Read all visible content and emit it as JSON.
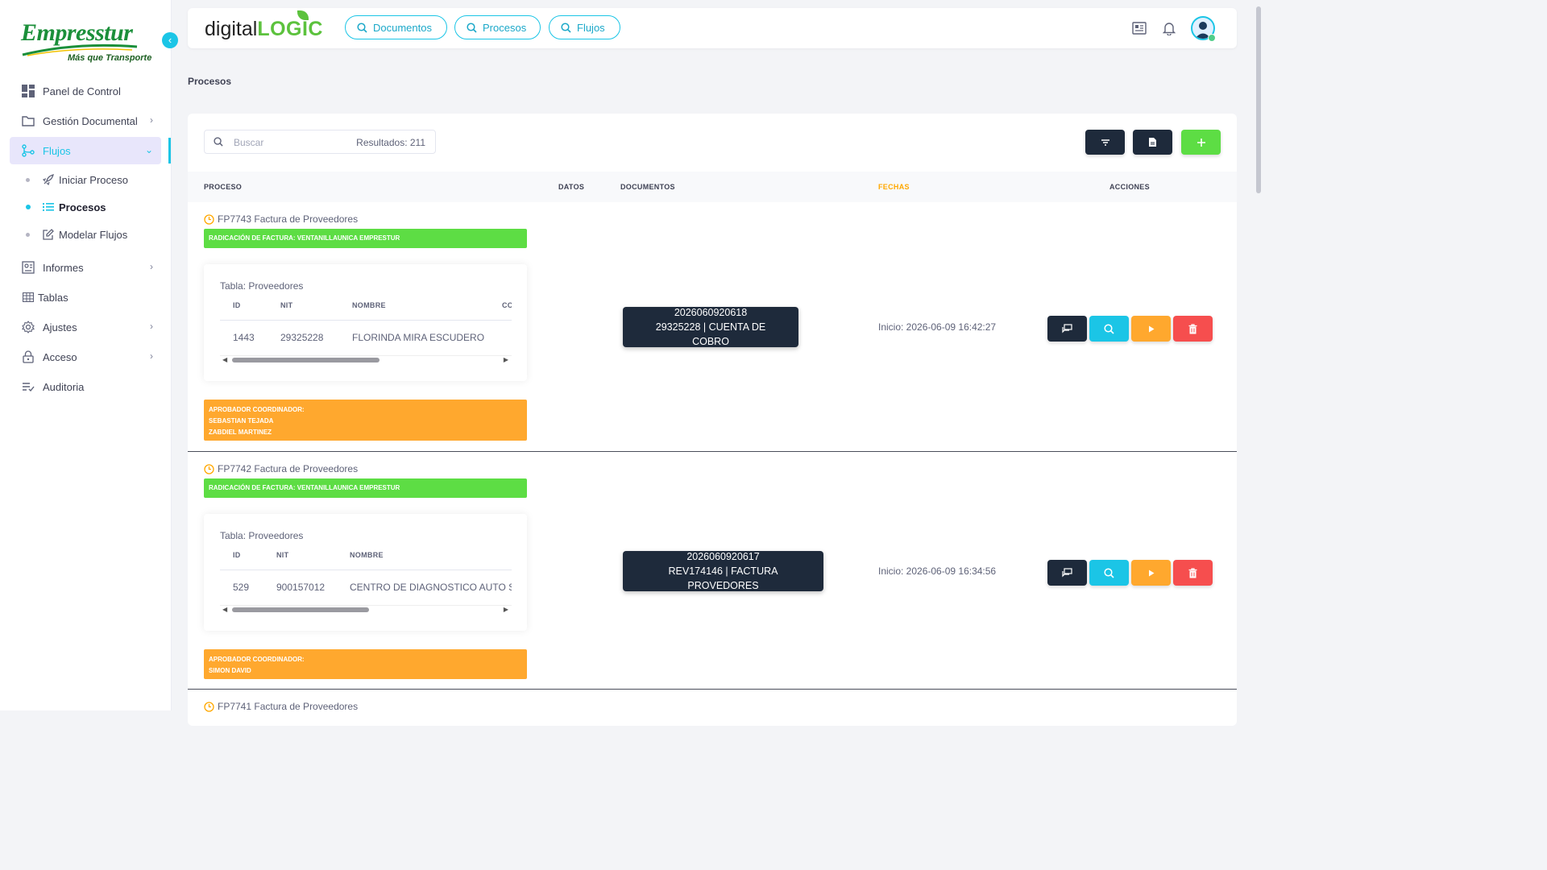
{
  "brand": {
    "name": "Empresstur",
    "tagline": "Más que Transporte",
    "color": "#1b8f3a"
  },
  "sidebar": {
    "items": [
      {
        "label": "Panel de Control",
        "icon": "dashboard-icon"
      },
      {
        "label": "Gestión Documental",
        "icon": "folder-icon",
        "has_children": true
      },
      {
        "label": "Flujos",
        "icon": "flow-icon",
        "active": true,
        "expanded": true
      },
      {
        "label": "Informes",
        "icon": "report-icon",
        "has_children": true
      },
      {
        "label": "Tablas",
        "icon": "table-icon"
      },
      {
        "label": "Ajustes",
        "icon": "gear-icon",
        "has_children": true
      },
      {
        "label": "Acceso",
        "icon": "lock-icon",
        "has_children": true
      },
      {
        "label": "Auditoria",
        "icon": "audit-icon"
      }
    ],
    "subitems": [
      {
        "label": "Iniciar Proceso",
        "icon": "rocket-icon"
      },
      {
        "label": "Procesos",
        "icon": "list-icon",
        "active": true
      },
      {
        "label": "Modelar Flujos",
        "icon": "edit-icon"
      }
    ]
  },
  "header": {
    "logo_text_1": "digital",
    "logo_text_2": "LOGIC",
    "quick_search": [
      "Documentos",
      "Procesos",
      "Flujos"
    ]
  },
  "page": {
    "title": "Procesos"
  },
  "toolbar": {
    "search_placeholder": "Buscar",
    "results_label": "Resultados: 211",
    "buttons": [
      "filter-button",
      "export-button",
      "add-button"
    ]
  },
  "table": {
    "headers": {
      "proceso": "PROCESO",
      "datos": "DATOS",
      "documentos": "DOCUMENTOS",
      "fechas": "FECHAS",
      "acciones": "ACCIONES"
    }
  },
  "rows": [
    {
      "title": "FP7743 Factura de Proveedores",
      "stage": "RADICACIÓN DE FACTURA: VENTANILLAUNICA EMPRESTUR",
      "table_name": "Tabla: Proveedores",
      "cols": [
        "ID",
        "NIT",
        "NOMBRE",
        "CC"
      ],
      "values": [
        "1443",
        "29325228",
        "FLORINDA MIRA ESCUDERO",
        ""
      ],
      "approver_title": "APROBADOR COORDINADOR:",
      "approvers": [
        "SEBASTIAN TEJADA",
        "ZABDIEL MARTINEZ"
      ],
      "doc_number": "2026060920618",
      "doc_desc": "29325228 | CUENTA DE COBRO",
      "fecha": "Inicio: 2026-06-09 16:42:27"
    },
    {
      "title": "FP7742 Factura de Proveedores",
      "stage": "RADICACIÓN DE FACTURA: VENTANILLAUNICA EMPRESTUR",
      "table_name": "Tabla: Proveedores",
      "cols": [
        "ID",
        "NIT",
        "NOMBRE"
      ],
      "values": [
        "529",
        "900157012",
        "CENTRO DE DIAGNOSTICO AUTO SUR"
      ],
      "approver_title": "APROBADOR COORDINADOR:",
      "approvers": [
        "SIMON DAVID"
      ],
      "doc_number": "2026060920617",
      "doc_desc": "REV174146 | FACTURA PROVEDORES",
      "fecha": "Inicio: 2026-06-09 16:34:56"
    },
    {
      "title": "FP7741 Factura de Proveedores"
    }
  ],
  "colors": {
    "accent": "#1bc5e6",
    "green": "#5ddd44",
    "orange": "#ffa82e",
    "dark": "#1e2a3b",
    "red": "#f64e4e"
  }
}
